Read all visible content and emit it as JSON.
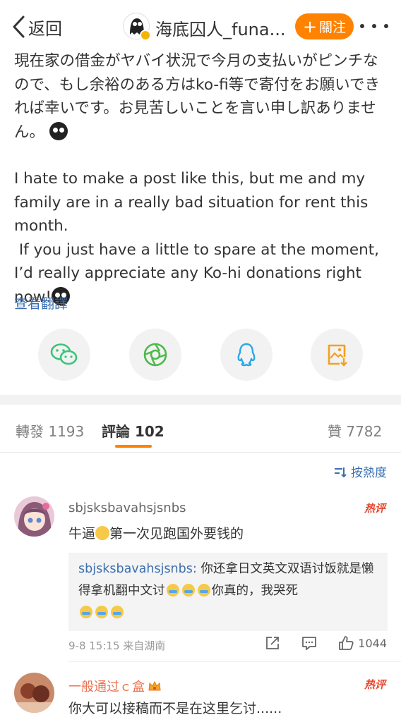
{
  "nav": {
    "back_label": "返回",
    "user_name": "海底囚人_funa...",
    "follow_label": "關注",
    "accent_color": "#ff8200"
  },
  "post": {
    "jp_text": "現在家の借金がヤバイ状況で今月の支払いがピンチなので、もし余裕のある方はko-fi等で寄付をお願いできれば幸いです。お見苦しいことを言い申し訳ありません。",
    "en_line1": "I hate to make a post like this, but me and my family are in a really bad situation for rent this month.",
    "en_line2": " If you just have a little to spare at the moment, I’d really appreciate any Ko-hi donations right now!",
    "translate_label": "查看翻譯"
  },
  "share": [
    "wechat-icon",
    "moments-icon",
    "qq-icon",
    "save-image-icon"
  ],
  "tabs": {
    "repost_label": "轉發",
    "repost_count": "1193",
    "comment_label": "評論",
    "comment_count": "102",
    "like_label": "贊",
    "like_count": "7782"
  },
  "sort_label": "按熱度",
  "comments": [
    {
      "user": "sbjsksbavahsjsnbs",
      "hot": "热评",
      "text_before": "牛逼",
      "text_after": "第一次见跑国外要钱的",
      "reply_user": "sbjsksbavahsjsnbs:",
      "reply_text_a": " 你还拿日文英文双语讨饭就是懒得拿机翻中文讨",
      "reply_text_b": "你真的，我哭死",
      "time": "9-8 15:15",
      "source": "来自湖南",
      "likes": "1044"
    },
    {
      "user": "一般通过ｃ盒",
      "hot": "热评",
      "text": "你大可以接稿而不是在这里乞讨......"
    }
  ]
}
